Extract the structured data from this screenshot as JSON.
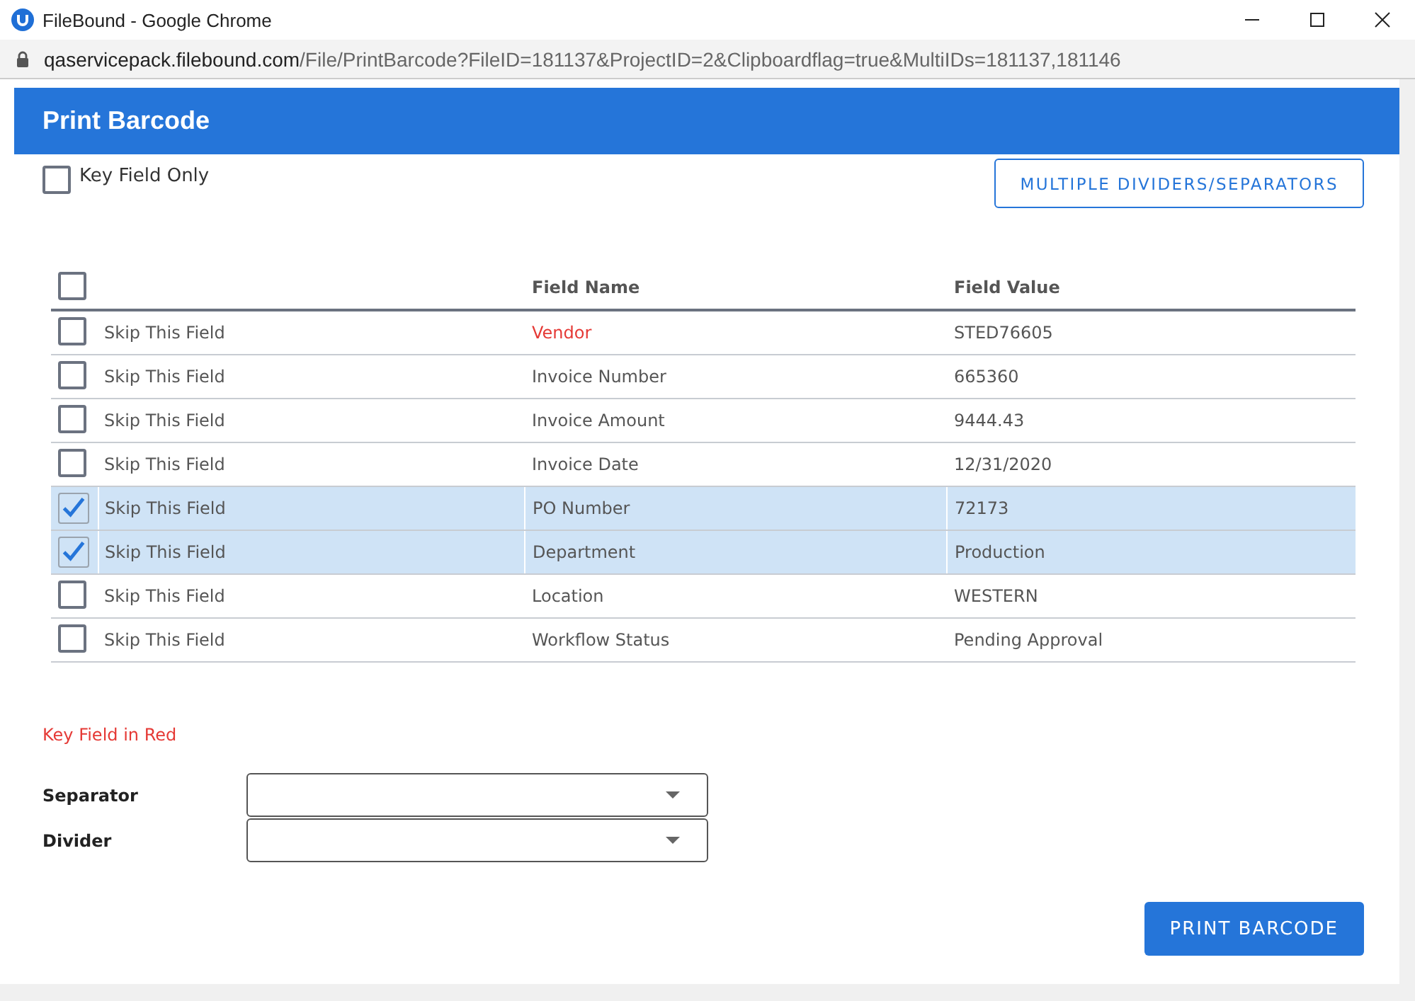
{
  "browser": {
    "title": "FileBound - Google Chrome",
    "url_host": "qaservicepack.filebound.com",
    "url_path": "/File/PrintBarcode?FileID=181137&ProjectID=2&Clipboardflag=true&MultiIDs=181137,181146"
  },
  "header": {
    "title": "Print Barcode"
  },
  "key_field_only": {
    "label": "Key Field Only",
    "checked": false
  },
  "multiple_button": "MULTIPLE DIVIDERS/SEPARATORS",
  "table": {
    "select_all": false,
    "columns": [
      "Field Name",
      "Field Value"
    ],
    "rows": [
      {
        "skip_label": "Skip This Field",
        "checked": false,
        "key": true,
        "name": "Vendor",
        "value": "STED76605"
      },
      {
        "skip_label": "Skip This Field",
        "checked": false,
        "key": false,
        "name": "Invoice Number",
        "value": "665360"
      },
      {
        "skip_label": "Skip This Field",
        "checked": false,
        "key": false,
        "name": "Invoice Amount",
        "value": "9444.43"
      },
      {
        "skip_label": "Skip This Field",
        "checked": false,
        "key": false,
        "name": "Invoice Date",
        "value": "12/31/2020"
      },
      {
        "skip_label": "Skip This Field",
        "checked": true,
        "key": false,
        "name": "PO Number",
        "value": "72173"
      },
      {
        "skip_label": "Skip This Field",
        "checked": true,
        "key": false,
        "name": "Department",
        "value": "Production"
      },
      {
        "skip_label": "Skip This Field",
        "checked": false,
        "key": false,
        "name": "Location",
        "value": "WESTERN"
      },
      {
        "skip_label": "Skip This Field",
        "checked": false,
        "key": false,
        "name": "Workflow Status",
        "value": "Pending Approval"
      }
    ]
  },
  "key_note": "Key Field in Red",
  "fields": [
    {
      "label": "Separator"
    },
    {
      "label": "Divider"
    }
  ],
  "print_button": "PRINT BARCODE"
}
